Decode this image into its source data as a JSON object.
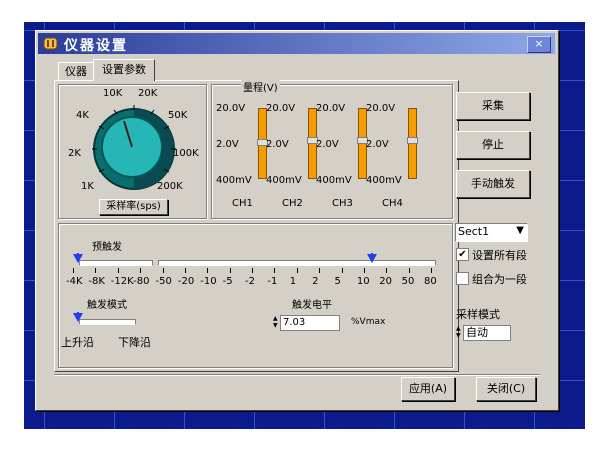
{
  "window": {
    "title": "仪器设置",
    "close_label": "×"
  },
  "tabs": [
    {
      "label": "仪器"
    },
    {
      "label": "设置参数"
    }
  ],
  "sample_rate": {
    "knob_labels": [
      "10K",
      "20K",
      "4K",
      "50K",
      "2K",
      "100K",
      "1K",
      "200K"
    ],
    "button_label": "采样率(sps)"
  },
  "range": {
    "title": "量程(V)",
    "row_labels": [
      "20.0V",
      "2.0V",
      "400mV"
    ],
    "channels": [
      "CH1",
      "CH2",
      "CH3",
      "CH4"
    ]
  },
  "trigger": {
    "pretrigger_label": "预触发",
    "scale_labels": [
      "-4K",
      "-8K",
      "-12K",
      "-80",
      "-50",
      "-20",
      "-10",
      "-5",
      "-2",
      "-1",
      "1",
      "2",
      "5",
      "10",
      "20",
      "50",
      "80"
    ],
    "mode_label": "触发模式",
    "edge_rising": "上升沿",
    "edge_falling": "下降沿",
    "level_label": "触发电平",
    "level_value": "7.03",
    "level_unit": "%Vmax"
  },
  "actions": {
    "collect": "采集",
    "stop": "停止",
    "manual_trigger": "手动触发"
  },
  "sect": {
    "selected": "Sect1",
    "set_all_label": "设置所有段",
    "set_all_checked": true,
    "merge_label": "组合为一段",
    "merge_checked": false
  },
  "sampling_mode": {
    "label": "采样模式",
    "value": "自动"
  },
  "footer": {
    "apply": "应用(A)",
    "close": "关闭(C)"
  }
}
